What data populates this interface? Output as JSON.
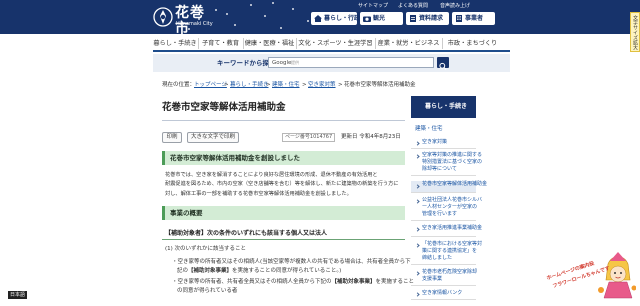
{
  "header": {
    "logo_name": "花巻市",
    "logo_roman": "Hanamaki City",
    "utility_links": [
      "サイトマップ",
      "よくある質問",
      "音声読み上げ"
    ],
    "quick_links": [
      {
        "label": "暮らし・行政",
        "icon": "house-icon"
      },
      {
        "label": "観光",
        "icon": "camera-icon"
      },
      {
        "label": "資料請求",
        "icon": "document-icon"
      },
      {
        "label": "事業者",
        "icon": "building-icon"
      }
    ],
    "size_notice": "文字サイズ拡大"
  },
  "global_nav": [
    "暮らし・手続き",
    "子育て・教育",
    "健康・医療・福祉",
    "文化・スポーツ・生涯学習",
    "産業・就労・ビジネス",
    "市政・まちづくり"
  ],
  "search": {
    "label": "キーワードから探す",
    "engine_label": "Google",
    "engine_sub": "提供"
  },
  "breadcrumb": {
    "prefix": "現在の位置：",
    "items": [
      "トップページ",
      "暮らし・手続き",
      "建築・住宅",
      "空き家対策"
    ],
    "current": "花巻市空家等解体活用補助金"
  },
  "main": {
    "title": "花巻市空家等解体活用補助金",
    "print_label": "印刷",
    "large_print_label": "大きな文字で印刷",
    "page_id": "ページ番号1014767",
    "updated": "更新日 令和4年8月23日",
    "heading1": "花巻市空家等解体活用補助金を創設しました",
    "paragraph1": [
      "花巻市では、空き家を解消することにより良好な居住環境の形成、退休不動産の有効活用と",
      "耐震促進を図るため、市内の空家（空き店舗等を含む）等を解体し、新たに建築物の新築を行う方に",
      "対し、解体工事の一部を補助する花巻市空家等解体活用補助金を創設しました。"
    ],
    "heading2": "事業の概要",
    "sub_heading": "【補助対象者】次の条件のいずれにも該当する個人又は法人",
    "condition_intro": "(1) 次のいずれかに該当すること",
    "bullet1_line1": "空き家等の所有者又はその相続人(当該空家等が複数人の共有である場合は、共有者全員から下",
    "bullet1_line2_pre": "記の",
    "bullet1_line2_bold": "【補助対象事業】",
    "bullet1_line2_post": "を実施することの同意が得られていること。)",
    "bullet2_line1_pre": "空き家等の所有者、共有者全員又はその相続人全員から下記の",
    "bullet2_line1_bold": "【補助対象事業】",
    "bullet2_line1_post": "を実施すること",
    "bullet2_line2": "の同意が得られている者"
  },
  "side_nav": {
    "header": "暮らし・手続き",
    "category": "建築・住宅",
    "links": [
      {
        "lines": [
          "空き家対策"
        ],
        "current": false
      },
      {
        "lines": [
          "空家等対策の推進に関する",
          "特別措置法に基づく空家の",
          "除却等について"
        ],
        "current": false
      },
      {
        "lines": [
          "花巻市空家等解体活用補助金"
        ],
        "current": true
      },
      {
        "lines": [
          "公益社団法人花巻市シルバ",
          "ー人材センターが空家の",
          "管理を行います"
        ],
        "current": false
      },
      {
        "lines": [
          "空き家活用推進事業補助金"
        ],
        "current": false
      },
      {
        "lines": [
          "「花巻市における空家等対",
          "策に関する連携協定」を",
          "締結しました"
        ],
        "current": false
      },
      {
        "lines": [
          "花巻市老朽危険空家除却",
          "支援事業"
        ],
        "current": false
      },
      {
        "lines": [
          "空き家情報バンク"
        ],
        "current": false
      }
    ]
  },
  "footer": {
    "language_badge": "日本語"
  },
  "promo_banner": {
    "line1": "ホームページの案内役",
    "line2": "フラワーロールちゃんです"
  },
  "colors": {
    "header_bg": "#17336b",
    "heading_bg": "#d3ecd5",
    "heading_accent": "#4c9c58",
    "link": "#1a55a3"
  }
}
